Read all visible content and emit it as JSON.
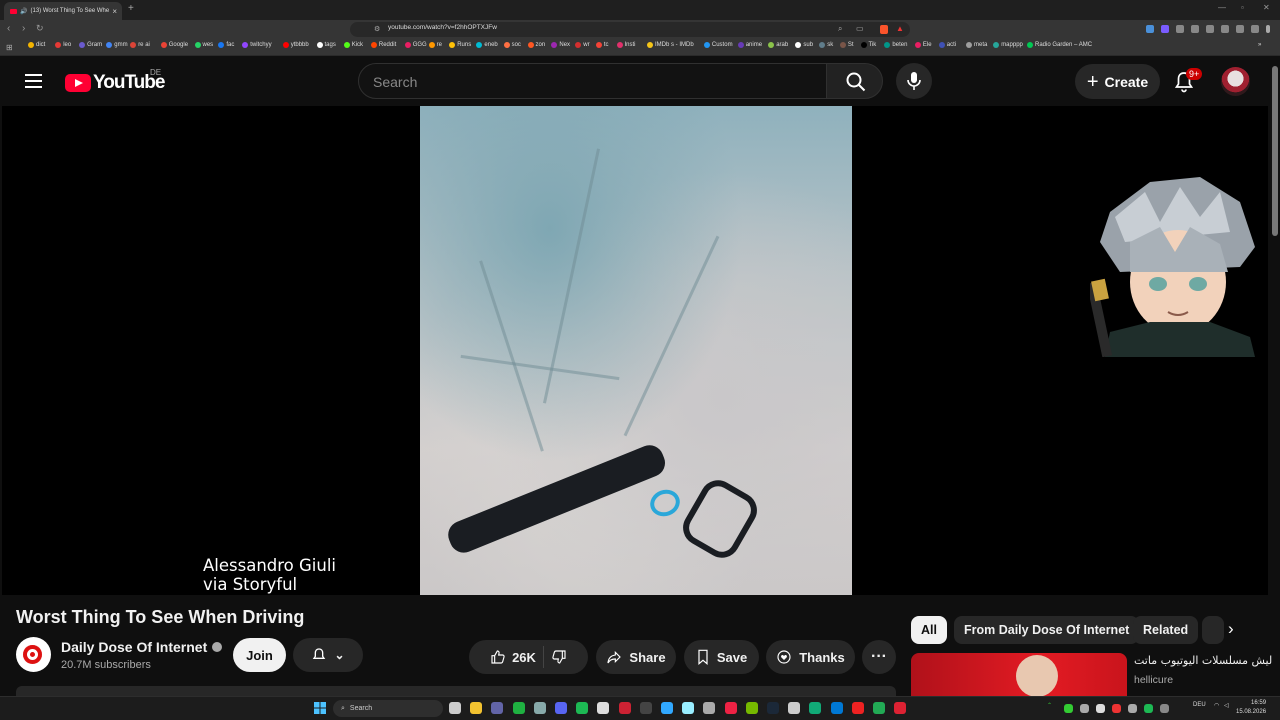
{
  "browser": {
    "tab_title": "(13) Worst Thing To See Whe",
    "tab_close": "×",
    "new_tab": "+",
    "url": "youtube.com/watch?v=f2hhOPTXJFw",
    "bookmarks": [
      "dict",
      "leo",
      "Gram",
      "gmm",
      "re ai",
      "Google",
      "wes",
      "fac",
      "twitchyy",
      "ytbbbb",
      "tags",
      "Kick",
      "Reddit",
      "GGG",
      "re",
      "Runs",
      "eneb",
      "soc",
      "zon",
      "Nex",
      "wr",
      "tc",
      "Insti",
      "IMDb s - IMDb",
      "Custom",
      "anime",
      "arab",
      "sub",
      "sk",
      "St",
      "Tik",
      "beten",
      "Ele",
      "acti",
      "meta",
      "mapppp",
      "Radio Garden – AMC"
    ]
  },
  "header": {
    "logo_word": "YouTube",
    "country": "DE",
    "search_placeholder": "Search",
    "create_label": "Create",
    "notif_badge": "9+"
  },
  "video": {
    "caption_line1": "Alessandro Giuli",
    "caption_line2": "via Storyful",
    "title": "Worst Thing To See When Driving"
  },
  "channel": {
    "name": "Daily Dose Of Internet",
    "subscribers": "20.7M subscribers",
    "join_label": "Join"
  },
  "actions": {
    "likes": "26K",
    "share": "Share",
    "save": "Save",
    "thanks": "Thanks",
    "more": "···"
  },
  "chips": [
    "All",
    "From Daily Dose Of Internet",
    "Related"
  ],
  "related": {
    "title": "ليش مسلسلات اليوتيوب ماتت",
    "channel": "hellicure"
  },
  "taskbar": {
    "search_label": "Search",
    "lang": "DEU",
    "time": "16:59",
    "date": "15.08.2026"
  }
}
